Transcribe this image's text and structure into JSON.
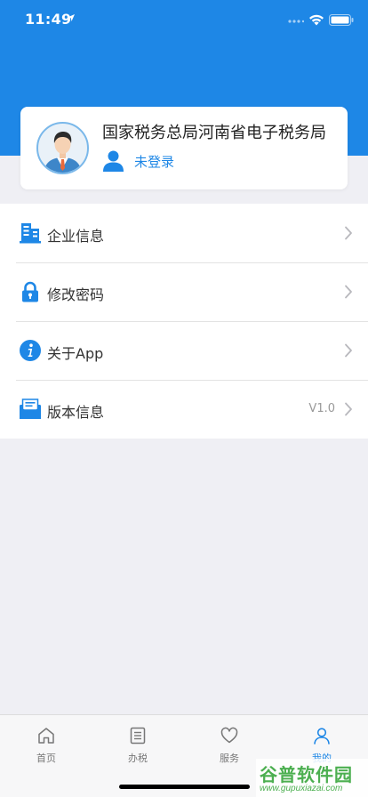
{
  "status_bar": {
    "time": "11:49"
  },
  "profile": {
    "org_name": "国家税务总局河南省电子税务局",
    "login_status": "未登录"
  },
  "menu": [
    {
      "label": "企业信息",
      "value": "",
      "icon": "building-icon"
    },
    {
      "label": "修改密码",
      "value": "",
      "icon": "lock-icon"
    },
    {
      "label": "关于App",
      "value": "",
      "icon": "info-icon"
    },
    {
      "label": "版本信息",
      "value": "V1.0",
      "icon": "mail-icon"
    }
  ],
  "tabs": [
    {
      "label": "首页",
      "icon": "home-icon"
    },
    {
      "label": "办税",
      "icon": "list-icon"
    },
    {
      "label": "服务",
      "icon": "heart-icon"
    },
    {
      "label": "我的",
      "icon": "person-icon",
      "active": true
    }
  ],
  "watermark": {
    "title": "谷普软件园",
    "url": "www.gupuxiazai.com"
  },
  "colors": {
    "accent": "#1e87e6",
    "background": "#efeff4"
  }
}
